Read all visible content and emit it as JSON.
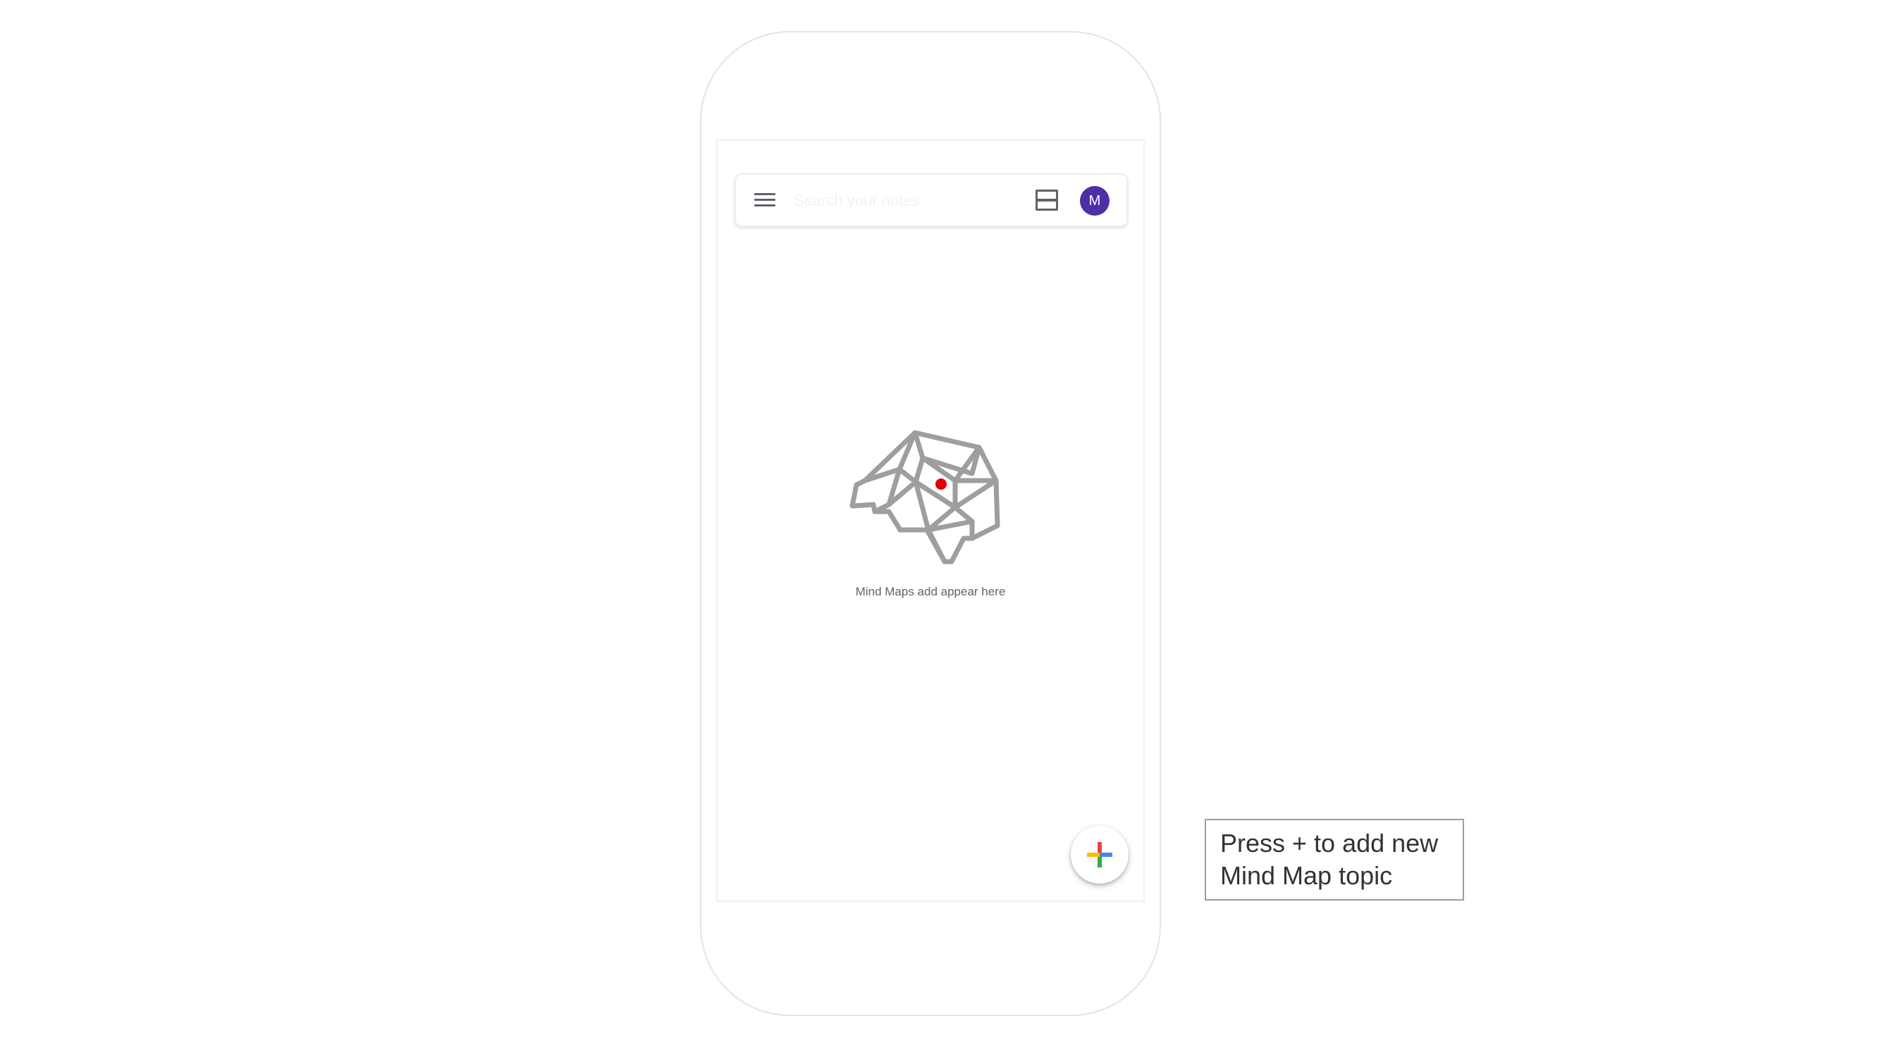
{
  "header": {
    "menu_icon": "hamburger-menu-icon",
    "search_placeholder": "Search your notes",
    "view_toggle_icon": "list-view-icon",
    "avatar_initial": "M"
  },
  "empty_state": {
    "illustration_icon": "brain-icon",
    "message": "Mind Maps add appear here"
  },
  "fab": {
    "icon": "plus-icon",
    "colors": [
      "#ea4335",
      "#fbbc04",
      "#34a853",
      "#4285f4"
    ]
  },
  "callout": {
    "line1": "Press + to add new",
    "line2": "Mind Map topic"
  },
  "colors": {
    "avatar": "#4f2ea7",
    "brain_outline": "#9e9e9e",
    "brain_dot": "#e00000"
  }
}
